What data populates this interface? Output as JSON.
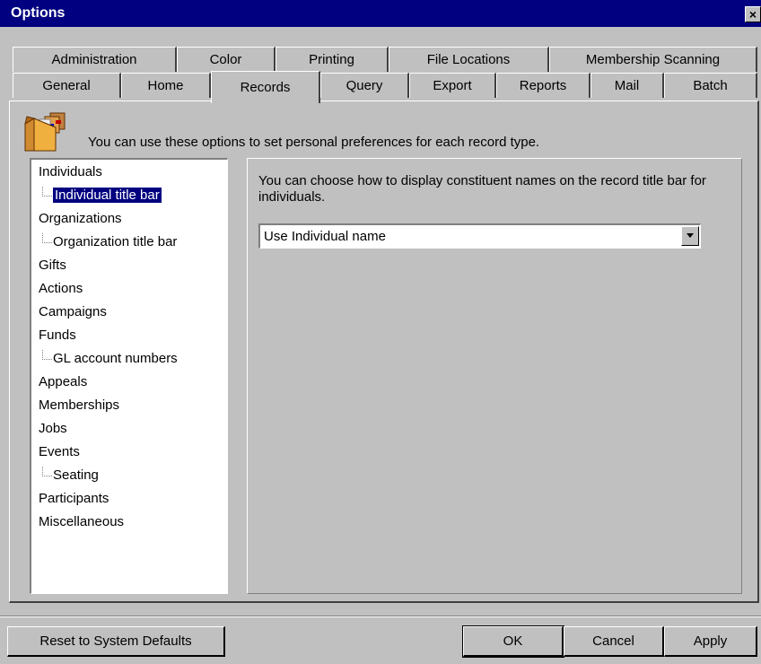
{
  "window": {
    "title": "Options",
    "close_glyph": "×"
  },
  "tabs_row1": [
    {
      "label": "Administration"
    },
    {
      "label": "Color"
    },
    {
      "label": "Printing"
    },
    {
      "label": "File Locations"
    },
    {
      "label": "Membership Scanning"
    }
  ],
  "tabs_row2": [
    {
      "label": "General"
    },
    {
      "label": "Home"
    },
    {
      "label": "Records"
    },
    {
      "label": "Query"
    },
    {
      "label": "Export"
    },
    {
      "label": "Reports"
    },
    {
      "label": "Mail"
    },
    {
      "label": "Batch"
    }
  ],
  "active_tab": "Records",
  "intro": "You can use these options to set personal preferences for each record type.",
  "tree": [
    {
      "label": "Individuals"
    },
    {
      "label": "Individual title bar",
      "selected": true
    },
    {
      "label": "Organizations"
    },
    {
      "label": "Organization title bar"
    },
    {
      "label": "Gifts"
    },
    {
      "label": "Actions"
    },
    {
      "label": "Campaigns"
    },
    {
      "label": "Funds"
    },
    {
      "label": "GL account numbers"
    },
    {
      "label": "Appeals"
    },
    {
      "label": "Memberships"
    },
    {
      "label": "Jobs"
    },
    {
      "label": "Events"
    },
    {
      "label": "Seating"
    },
    {
      "label": "Participants"
    },
    {
      "label": "Miscellaneous"
    }
  ],
  "detail": {
    "description": "You can choose how to display constituent names on the record title bar for individuals.",
    "combo_value": "Use Individual name"
  },
  "buttons": {
    "reset": "Reset to System Defaults",
    "ok": "OK",
    "cancel": "Cancel",
    "apply": "Apply"
  },
  "colors": {
    "titlebar": "#000080",
    "face": "#c0c0c0",
    "selection": "#000080"
  },
  "icons": {
    "folder": "folder-icon",
    "dropdown": "dropdown-arrow-icon",
    "close": "close-icon"
  }
}
